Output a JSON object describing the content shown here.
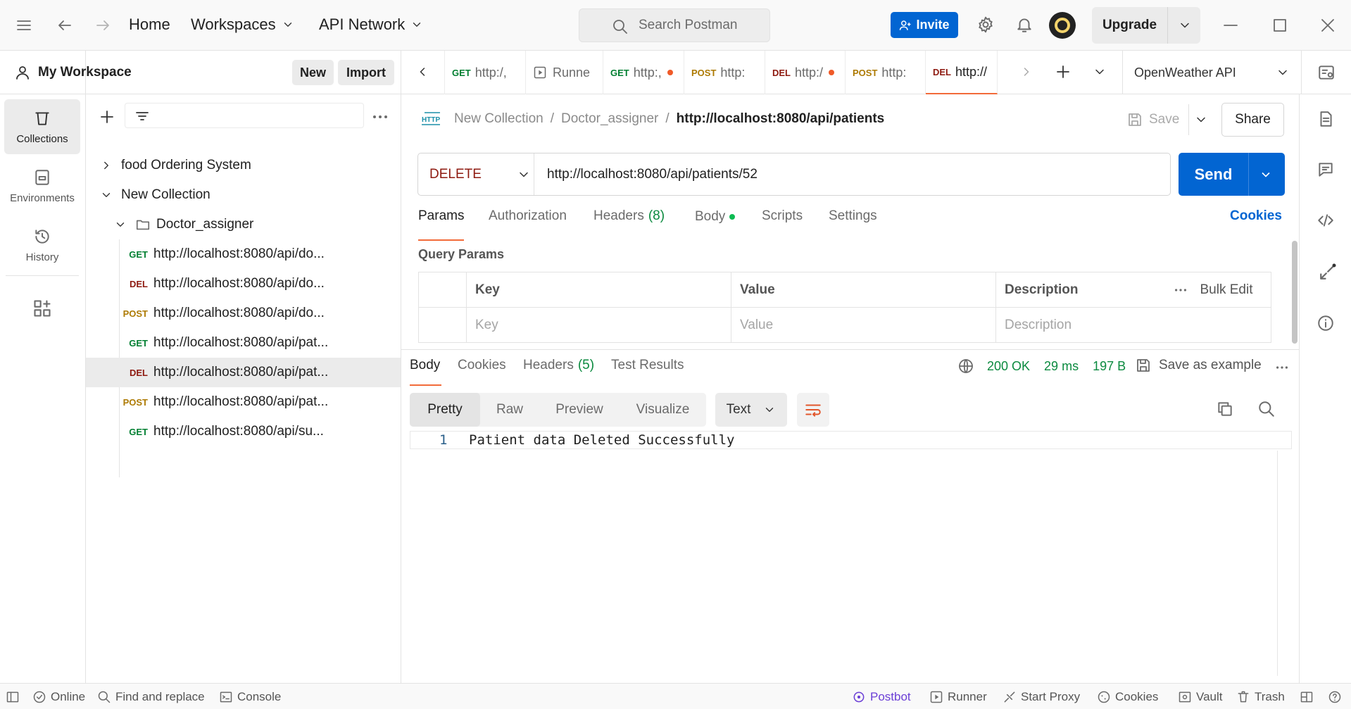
{
  "topbar": {
    "nav": [
      "Home",
      "Workspaces",
      "API Network"
    ],
    "search_placeholder": "Search Postman",
    "invite_label": "Invite",
    "upgrade_label": "Upgrade"
  },
  "rail": {
    "items": [
      {
        "label": "Collections",
        "icon": "trash-can-icon"
      },
      {
        "label": "Environments",
        "icon": "environments-icon"
      },
      {
        "label": "History",
        "icon": "history-icon"
      }
    ]
  },
  "sidebar": {
    "workspace_name": "My Workspace",
    "new_label": "New",
    "import_label": "Import",
    "tree": [
      {
        "label": "food Ordering System",
        "expanded": false
      },
      {
        "label": "New Collection",
        "expanded": true
      },
      {
        "label": "Doctor_assigner",
        "expanded": true
      },
      {
        "method": "GET",
        "label": "http://localhost:8080/api/do..."
      },
      {
        "method": "DEL",
        "label": "http://localhost:8080/api/do..."
      },
      {
        "method": "POST",
        "label": "http://localhost:8080/api/do..."
      },
      {
        "method": "GET",
        "label": "http://localhost:8080/api/pat..."
      },
      {
        "method": "DEL",
        "label": "http://localhost:8080/api/pat...",
        "selected": true
      },
      {
        "method": "POST",
        "label": "http://localhost:8080/api/pat..."
      },
      {
        "method": "GET",
        "label": "http://localhost:8080/api/su..."
      }
    ]
  },
  "tabs": [
    {
      "method": "GET",
      "label": "http:/,"
    },
    {
      "method": "",
      "label": "Runne"
    },
    {
      "method": "GET",
      "label": "http:,",
      "unsaved": true
    },
    {
      "method": "POST",
      "label": "http:"
    },
    {
      "method": "DEL",
      "label": "http:/",
      "unsaved": true
    },
    {
      "method": "POST",
      "label": "http:"
    },
    {
      "method": "DEL",
      "label": "http://",
      "active": true
    }
  ],
  "environment": "OpenWeather API",
  "request": {
    "breadcrumb": [
      "New Collection",
      "Doctor_assigner"
    ],
    "name": "http://localhost:8080/api/patients",
    "save_label": "Save",
    "share_label": "Share",
    "method": "DELETE",
    "url": "http://localhost:8080/api/patients/52",
    "send_label": "Send",
    "tabs": [
      "Params",
      "Authorization",
      "Headers",
      "Body",
      "Scripts",
      "Settings"
    ],
    "headers_count": "(8)",
    "cookies_label": "Cookies",
    "query_params_title": "Query Params",
    "columns": [
      "Key",
      "Value",
      "Description"
    ],
    "bulk_edit_label": "Bulk Edit",
    "placeholders": [
      "Key",
      "Value",
      "Description"
    ]
  },
  "response": {
    "tabs": [
      "Body",
      "Cookies",
      "Headers",
      "Test Results"
    ],
    "headers_count": "(5)",
    "status": "200 OK",
    "time": "29 ms",
    "size": "197 B",
    "save_example_label": "Save as example",
    "views": [
      "Pretty",
      "Raw",
      "Preview",
      "Visualize"
    ],
    "format": "Text",
    "line_number": "1",
    "body": "Patient data Deleted Successfully"
  },
  "statusbar": {
    "left": [
      "Online",
      "Find and replace",
      "Console"
    ],
    "right": [
      "Postbot",
      "Runner",
      "Start Proxy",
      "Cookies",
      "Vault",
      "Trash"
    ]
  },
  "colors": {
    "accent": "#0265d2",
    "tab_underline": "#f26b3a",
    "get": "#007f31",
    "delete": "#8e1a10",
    "post": "#ad7a03",
    "success": "#0b8a3f"
  }
}
